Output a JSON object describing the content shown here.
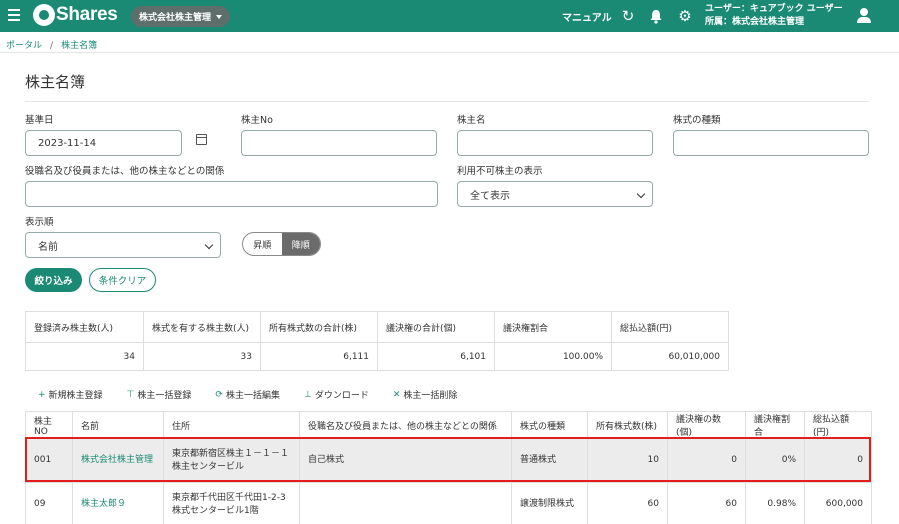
{
  "header": {
    "logo_text": "Shares",
    "company_selector": "株式会社株主管理",
    "manual": "マニュアル",
    "user_line": "ユーザー：キュアブック ユーザー",
    "affiliation_line": "所属：株式会社株主管理",
    "icons": [
      "menu-icon",
      "refresh-icon",
      "bell-icon",
      "gear-icon",
      "user-icon"
    ]
  },
  "breadcrumb": [
    "ポータル",
    "株主名簿"
  ],
  "page_title": "株主名簿",
  "form": {
    "base_date_label": "基準日",
    "base_date_value": "2023-11-14",
    "shareholder_no_label": "株主No",
    "shareholder_no_value": "",
    "shareholder_name_label": "株主名",
    "shareholder_name_value": "",
    "stock_type_label": "株式の種類",
    "stock_type_value": "",
    "relation_label": "役職名及び役員または、他の株主などとの関係",
    "relation_value": "",
    "unusable_label": "利用不可株主の表示",
    "unusable_value": "全て表示",
    "order_label": "表示順",
    "order_value": "名前",
    "sort_asc": "昇順",
    "sort_desc": "降順",
    "sort_selected": "降順",
    "filter_button": "絞り込み",
    "clear_button": "条件クリア"
  },
  "summary": {
    "headers": [
      "登録済み株主数(人)",
      "株式を有する株主数(人)",
      "所有株式数の合計(株)",
      "議決権の合計(個)",
      "議決権割合",
      "総払込額(円)"
    ],
    "values": [
      "34",
      "33",
      "6,111",
      "6,101",
      "100.00%",
      "60,010,000"
    ]
  },
  "actions": [
    {
      "icon": "+",
      "label": "新規株主登録"
    },
    {
      "icon": "⊤",
      "label": "株主一括登録"
    },
    {
      "icon": "⟳",
      "label": "株主一括編集"
    },
    {
      "icon": "⊥",
      "label": "ダウンロード"
    },
    {
      "icon": "✕",
      "label": "株主一括削除"
    }
  ],
  "table": {
    "headers": [
      "株主NO",
      "名前",
      "住所",
      "役職名及び役員または、他の株主などとの関係",
      "株式の種類",
      "所有株式数(株)",
      "議決権の数(個)",
      "議決権割合",
      "総払込額(円)"
    ],
    "rows": [
      {
        "no": "001",
        "name": "株式会社株主管理",
        "address1": "東京都新宿区株主１－１－１",
        "address2": "株主センタービル",
        "relation": "自己株式",
        "type": "普通株式",
        "shares": "10",
        "votes": "0",
        "ratio": "0%",
        "paid": "0"
      },
      {
        "no": "09",
        "name": "株主太郎９",
        "address1": "東京都千代田区千代田1-2-3",
        "address2": "株式センタービル1階",
        "relation": "",
        "type": "譲渡制限株式",
        "shares": "60",
        "votes": "60",
        "ratio": "0.98%",
        "paid": "600,000"
      }
    ]
  },
  "colors": {
    "brand": "#1a8a75",
    "highlight": "#e21d1d",
    "chip": "#5e6e6a"
  }
}
